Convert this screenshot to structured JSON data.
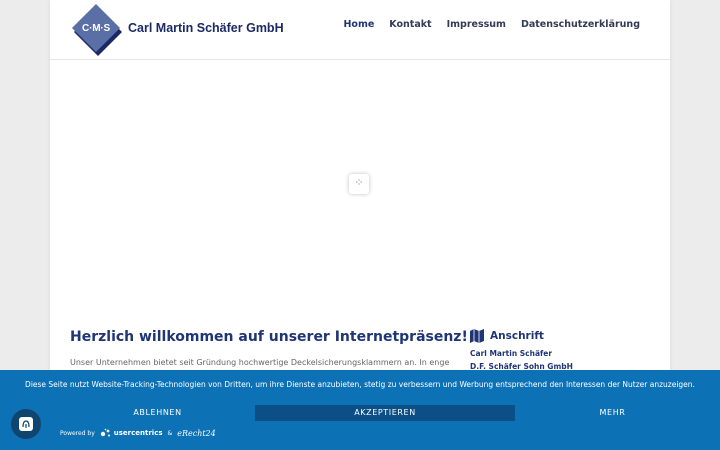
{
  "header": {
    "logo_text": "C·M·S",
    "company_name": "Carl Martin Schäfer GmbH",
    "nav": [
      {
        "label": "Home",
        "active": true
      },
      {
        "label": "Kontakt",
        "active": false
      },
      {
        "label": "Impressum",
        "active": false
      },
      {
        "label": "Datenschutzerklärung",
        "active": false
      }
    ]
  },
  "slider": {
    "loader_icon": "loading-spinner-icon"
  },
  "main": {
    "title": "Herzlich willkommen auf unserer Internetpräsenz!",
    "intro": "Unser Unternehmen bietet seit Gründung hochwertige Deckelsicherungsklammern an. In enger"
  },
  "sidebar": {
    "heading": "Anschrift",
    "icon": "map-icon",
    "lines": [
      "Carl Martin Schäfer",
      "D.F. Schäfer Sohn GmbH"
    ]
  },
  "cookie_banner": {
    "text": "Diese Seite nutzt Website-Tracking-Technologien von Dritten, um ihre Dienste anzubieten, stetig zu verbessern und Werbung entsprechend den Interessen der Nutzer anzuzeigen.",
    "decline_label": "ABLEHNEN",
    "accept_label": "AKZEPTIEREN",
    "more_label": "MEHR",
    "powered_by": "Powered by",
    "usercentrics": "usercentrics",
    "amp": "&",
    "erecht": "eRecht24"
  },
  "colors": {
    "brand": "#1f3575",
    "cookie_bar": "#0d71b6",
    "accept_button": "#0b4f86"
  }
}
